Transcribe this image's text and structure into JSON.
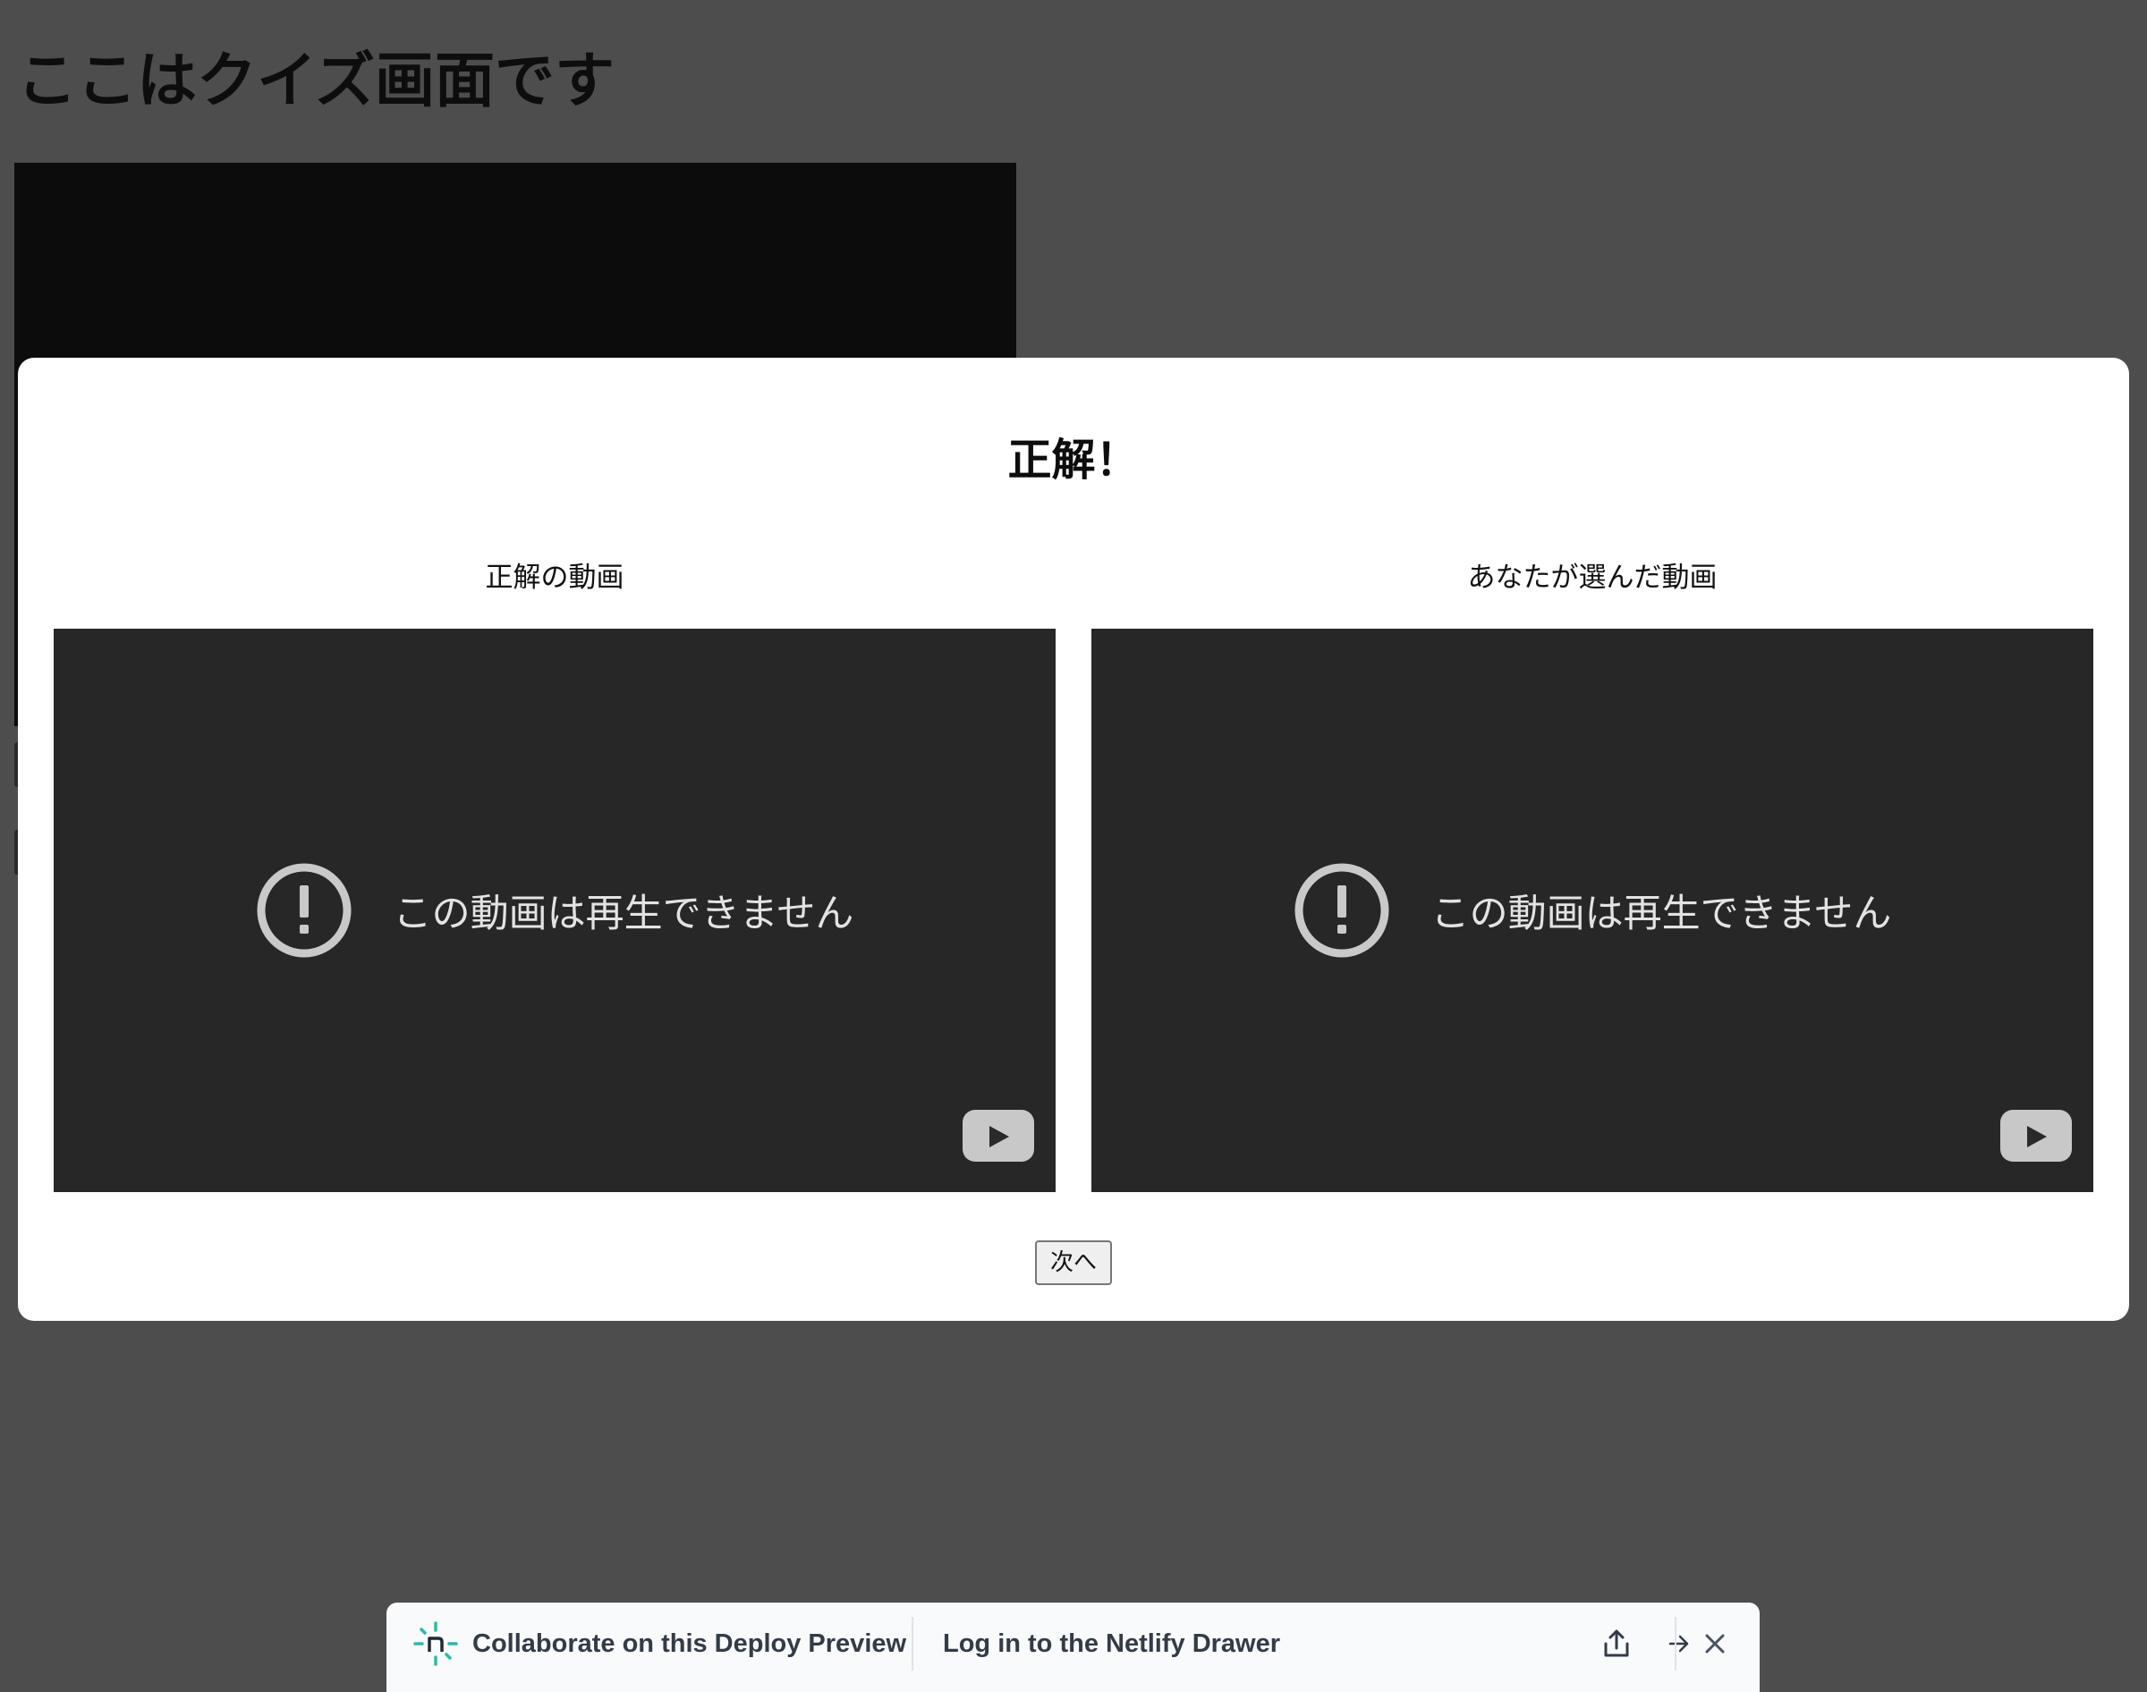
{
  "page": {
    "title": "ここはクイズ画面です"
  },
  "modal": {
    "title": "正解！",
    "correct_video": {
      "label": "正解の動画",
      "error_message": "この動画は再生できません"
    },
    "selected_video": {
      "label": "あなたが選んだ動画",
      "error_message": "この動画は再生できません"
    },
    "next_button": "次へ"
  },
  "drawer": {
    "logo_icon": "netlify-logo-icon",
    "collaborate_text": "Collaborate on this Deploy Preview",
    "login_text": "Log in to the Netlify Drawer",
    "share_icon": "share-icon",
    "close_icon": "close-icon",
    "accent_color": "#2eb8a8",
    "text_color": "#333b48"
  },
  "colors": {
    "overlay_background": "#4d4d4d",
    "video_background": "#272727",
    "modal_background": "#ffffff"
  }
}
